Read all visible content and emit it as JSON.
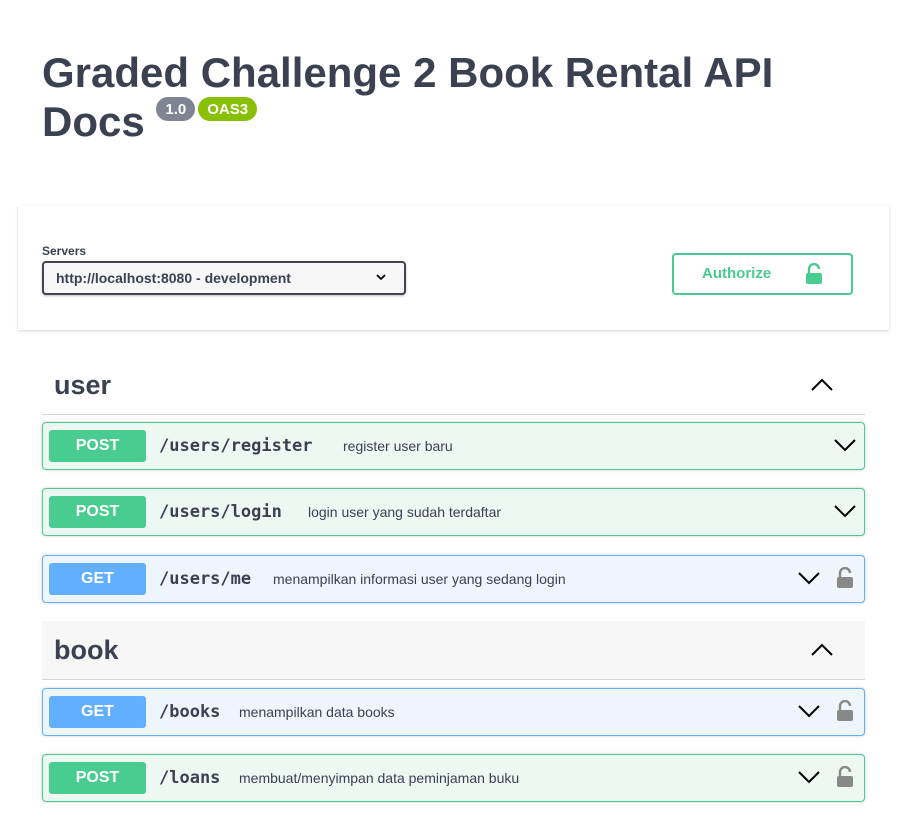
{
  "info": {
    "title": "Graded Challenge 2 Book Rental API Docs",
    "version": "1.0",
    "oas": "OAS3"
  },
  "servers": {
    "label": "Servers",
    "selected": "http://localhost:8080 - development"
  },
  "authorize": {
    "label": "Authorize",
    "icon": "unlocked-icon",
    "color": "#49cc90"
  },
  "colors": {
    "post": "#49cc90",
    "get": "#61affe",
    "text": "#3b4151"
  },
  "tags": [
    {
      "name": "user",
      "operations": [
        {
          "method": "POST",
          "path": "/users/register",
          "summary": "register user baru",
          "locked": false
        },
        {
          "method": "POST",
          "path": "/users/login",
          "summary": "login user yang sudah terdaftar",
          "locked": false
        },
        {
          "method": "GET",
          "path": "/users/me",
          "summary": "menampilkan informasi user yang sedang login",
          "locked": true
        }
      ]
    },
    {
      "name": "book",
      "operations": [
        {
          "method": "GET",
          "path": "/books",
          "summary": "menampilkan data books",
          "locked": true
        },
        {
          "method": "POST",
          "path": "/loans",
          "summary": "membuat/menyimpan data peminjaman buku",
          "locked": true
        }
      ]
    }
  ]
}
